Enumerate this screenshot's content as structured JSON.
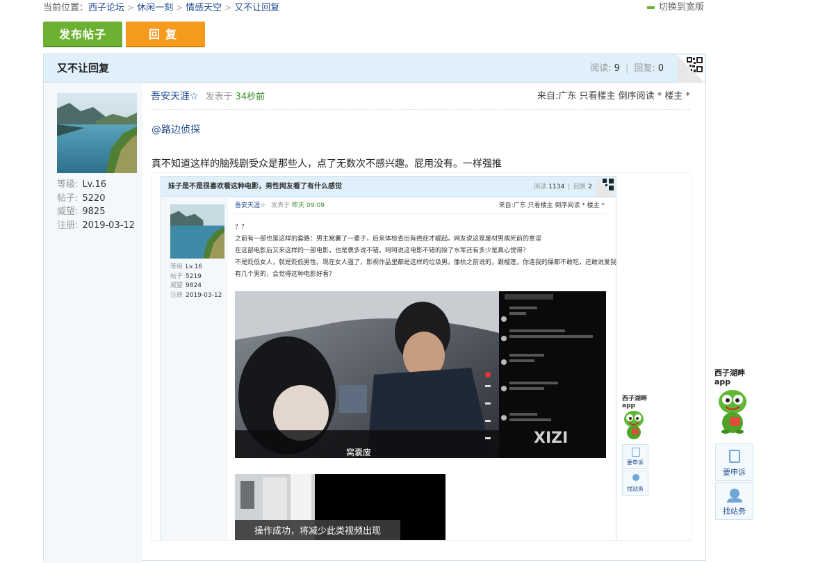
{
  "breadcrumb": {
    "prefix": "当前位置：",
    "items": [
      "西子论坛",
      "休闲一刻",
      "情感天空"
    ],
    "current": "又不让回复",
    "switch_label": "切换到宽版"
  },
  "toolbar": {
    "post_label": "发布帖子",
    "reply_label": "回复"
  },
  "thread": {
    "title": "又不让回复",
    "reads_label": "阅读:",
    "reads": "9",
    "replies_label": "回复:",
    "replies": "0",
    "separator": "|"
  },
  "author": {
    "name": "吾安天涯☆",
    "level_label": "等级:",
    "level": "Lv.16",
    "posts_label": "帖子:",
    "posts": "5220",
    "prestige_label": "威望:",
    "prestige": "9825",
    "reg_label": "注册:",
    "reg_date": "2019-03-12"
  },
  "post": {
    "posted_label": "发表于",
    "time": "34秒前",
    "meta_right": "来自:广东 只看楼主  倒序阅读 * 楼主 *",
    "mention": "@路边侦探",
    "text": "真不知道这样的脑残剧受众是那些人，点了无数次不感兴趣。屁用没有。一样强推"
  },
  "embedded": {
    "title": "妹子是不是很喜欢看这种电影，男性网友看了有什么感觉",
    "reads_label": "阅读",
    "reads": "1134",
    "replies_label": "回复",
    "replies": "2",
    "author": "吾安天涯☆",
    "posted_label": "发表于",
    "time": "昨天 09:09",
    "meta_right": "来自:广东 只看楼主  倒序阅读 * 楼主 *",
    "level_label": "等级",
    "level": "Lv.16",
    "posts_label": "帖子",
    "posts": "5219",
    "prestige_label": "威望",
    "prestige": "9824",
    "reg_label": "注册",
    "reg_date": "2019-03-12",
    "body_lines": [
      "？？",
      "之前有一部也是这样的套路：男主窝囊了一辈子，后来体检查出有癌症才崛起。网友说这是废材男病死前的意淫",
      "在这部电影后又来这样的一部电影，也是褒多说不错。呵呵说这电影不错的除了水军还有多少是真心觉得？",
      "不是贬低女人，就是贬低男性。现在女人强了，影视作品里都是这样的垃圾男。像杭之前说的，跟榴莲，你连我的屎都不敢吃，还敢说爱我",
      "有几个男的，会觉得这种电影好看？"
    ],
    "video_subtitle": "窝囊废",
    "video_watermark": "XIZI",
    "toast": "操作成功，将减少此类视频出现",
    "side_app_label": "西子湖畔 app",
    "side_appeal": "要申诉",
    "side_find": "找站务"
  },
  "sidebar": {
    "app_label_1": "西子湖畔",
    "app_label_2": "app",
    "appeal_label": "要申诉",
    "find_label": "找站务"
  },
  "colors": {
    "post_button": "#6cb131",
    "reply_button": "#f59a1c",
    "header_bg": "#dff0fb",
    "link": "#1f4a8c",
    "time_green": "#3a8c2a"
  }
}
